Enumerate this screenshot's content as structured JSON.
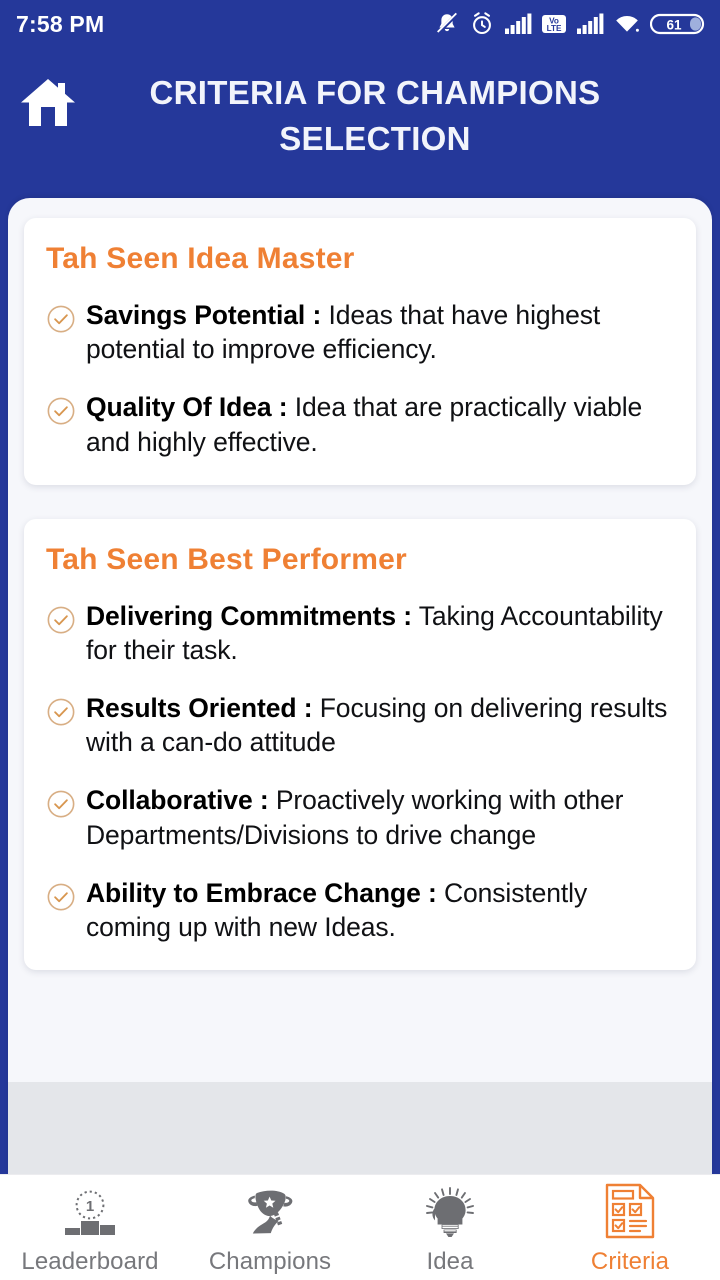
{
  "statusbar": {
    "time": "7:58 PM",
    "battery_level": "61",
    "icons": [
      "bell-muted-icon",
      "alarm-clock-icon",
      "signal-bars-icon",
      "volte-icon",
      "signal-bars-2-icon",
      "wifi-icon",
      "battery-icon"
    ],
    "volte_top": "Vo",
    "volte_bottom": "LTE"
  },
  "header": {
    "home_icon": "home-icon",
    "title": "CRITERIA FOR CHAMPIONS SELECTION"
  },
  "cards": [
    {
      "title": "Tah Seen Idea Master",
      "items": [
        {
          "term": "Savings Potential :",
          "desc": " Ideas that have highest potential to improve efficiency."
        },
        {
          "term": "Quality Of Idea :",
          "desc": " Idea that are practically viable and highly effective."
        }
      ]
    },
    {
      "title": "Tah Seen Best Performer",
      "items": [
        {
          "term": "Delivering Commitments :",
          "desc": " Taking Accountability for their task."
        },
        {
          "term": "Results Oriented :",
          "desc": " Focusing on delivering results with a can-do attitude"
        },
        {
          "term": "Collaborative :",
          "desc": " Proactively working with other Departments/Divisions to drive change"
        },
        {
          "term": "Ability to Embrace Change :",
          "desc": " Consistently coming up with new Ideas."
        }
      ]
    }
  ],
  "bottomnav": {
    "items": [
      {
        "label": "Leaderboard",
        "icon": "podium-icon",
        "active": false
      },
      {
        "label": "Champions",
        "icon": "trophy-icon",
        "active": false
      },
      {
        "label": "Idea",
        "icon": "lightbulb-head-icon",
        "active": false
      },
      {
        "label": "Criteria",
        "icon": "checklist-document-icon",
        "active": true
      }
    ]
  },
  "colors": {
    "brand_blue": "#25389a",
    "accent_orange": "#ef8034",
    "check_tan": "#d9a濃"
  }
}
